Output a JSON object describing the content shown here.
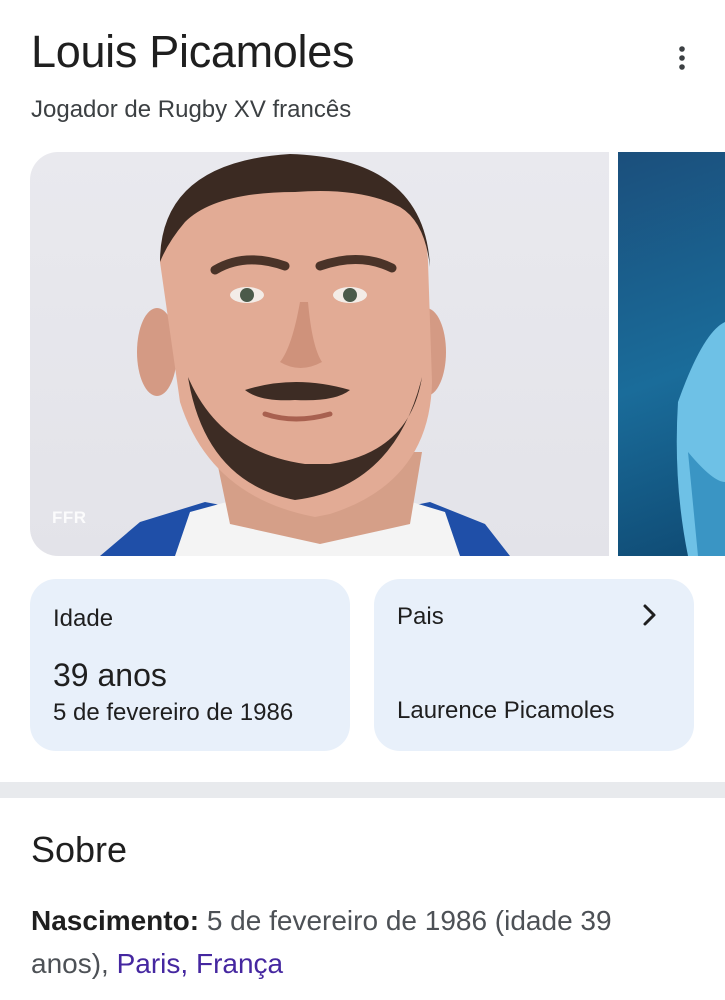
{
  "header": {
    "title": "Louis Picamoles",
    "subtitle": "Jogador de Rugby XV francês"
  },
  "images": {
    "main_credit": "FFR"
  },
  "cards": {
    "age": {
      "label": "Idade",
      "value": "39 anos",
      "sub": "5 de fevereiro de 1986"
    },
    "parents": {
      "label": "Pais",
      "value": "Laurence Picamoles"
    }
  },
  "about": {
    "heading": "Sobre",
    "birth_label": "Nascimento:",
    "birth_text": " 5 de fevereiro de 1986 (idade 39 anos), ",
    "birth_place": "Paris, França"
  },
  "colors": {
    "card_bg": "#e8f0fa",
    "link": "#4527a0",
    "divider": "#e8eaed"
  }
}
